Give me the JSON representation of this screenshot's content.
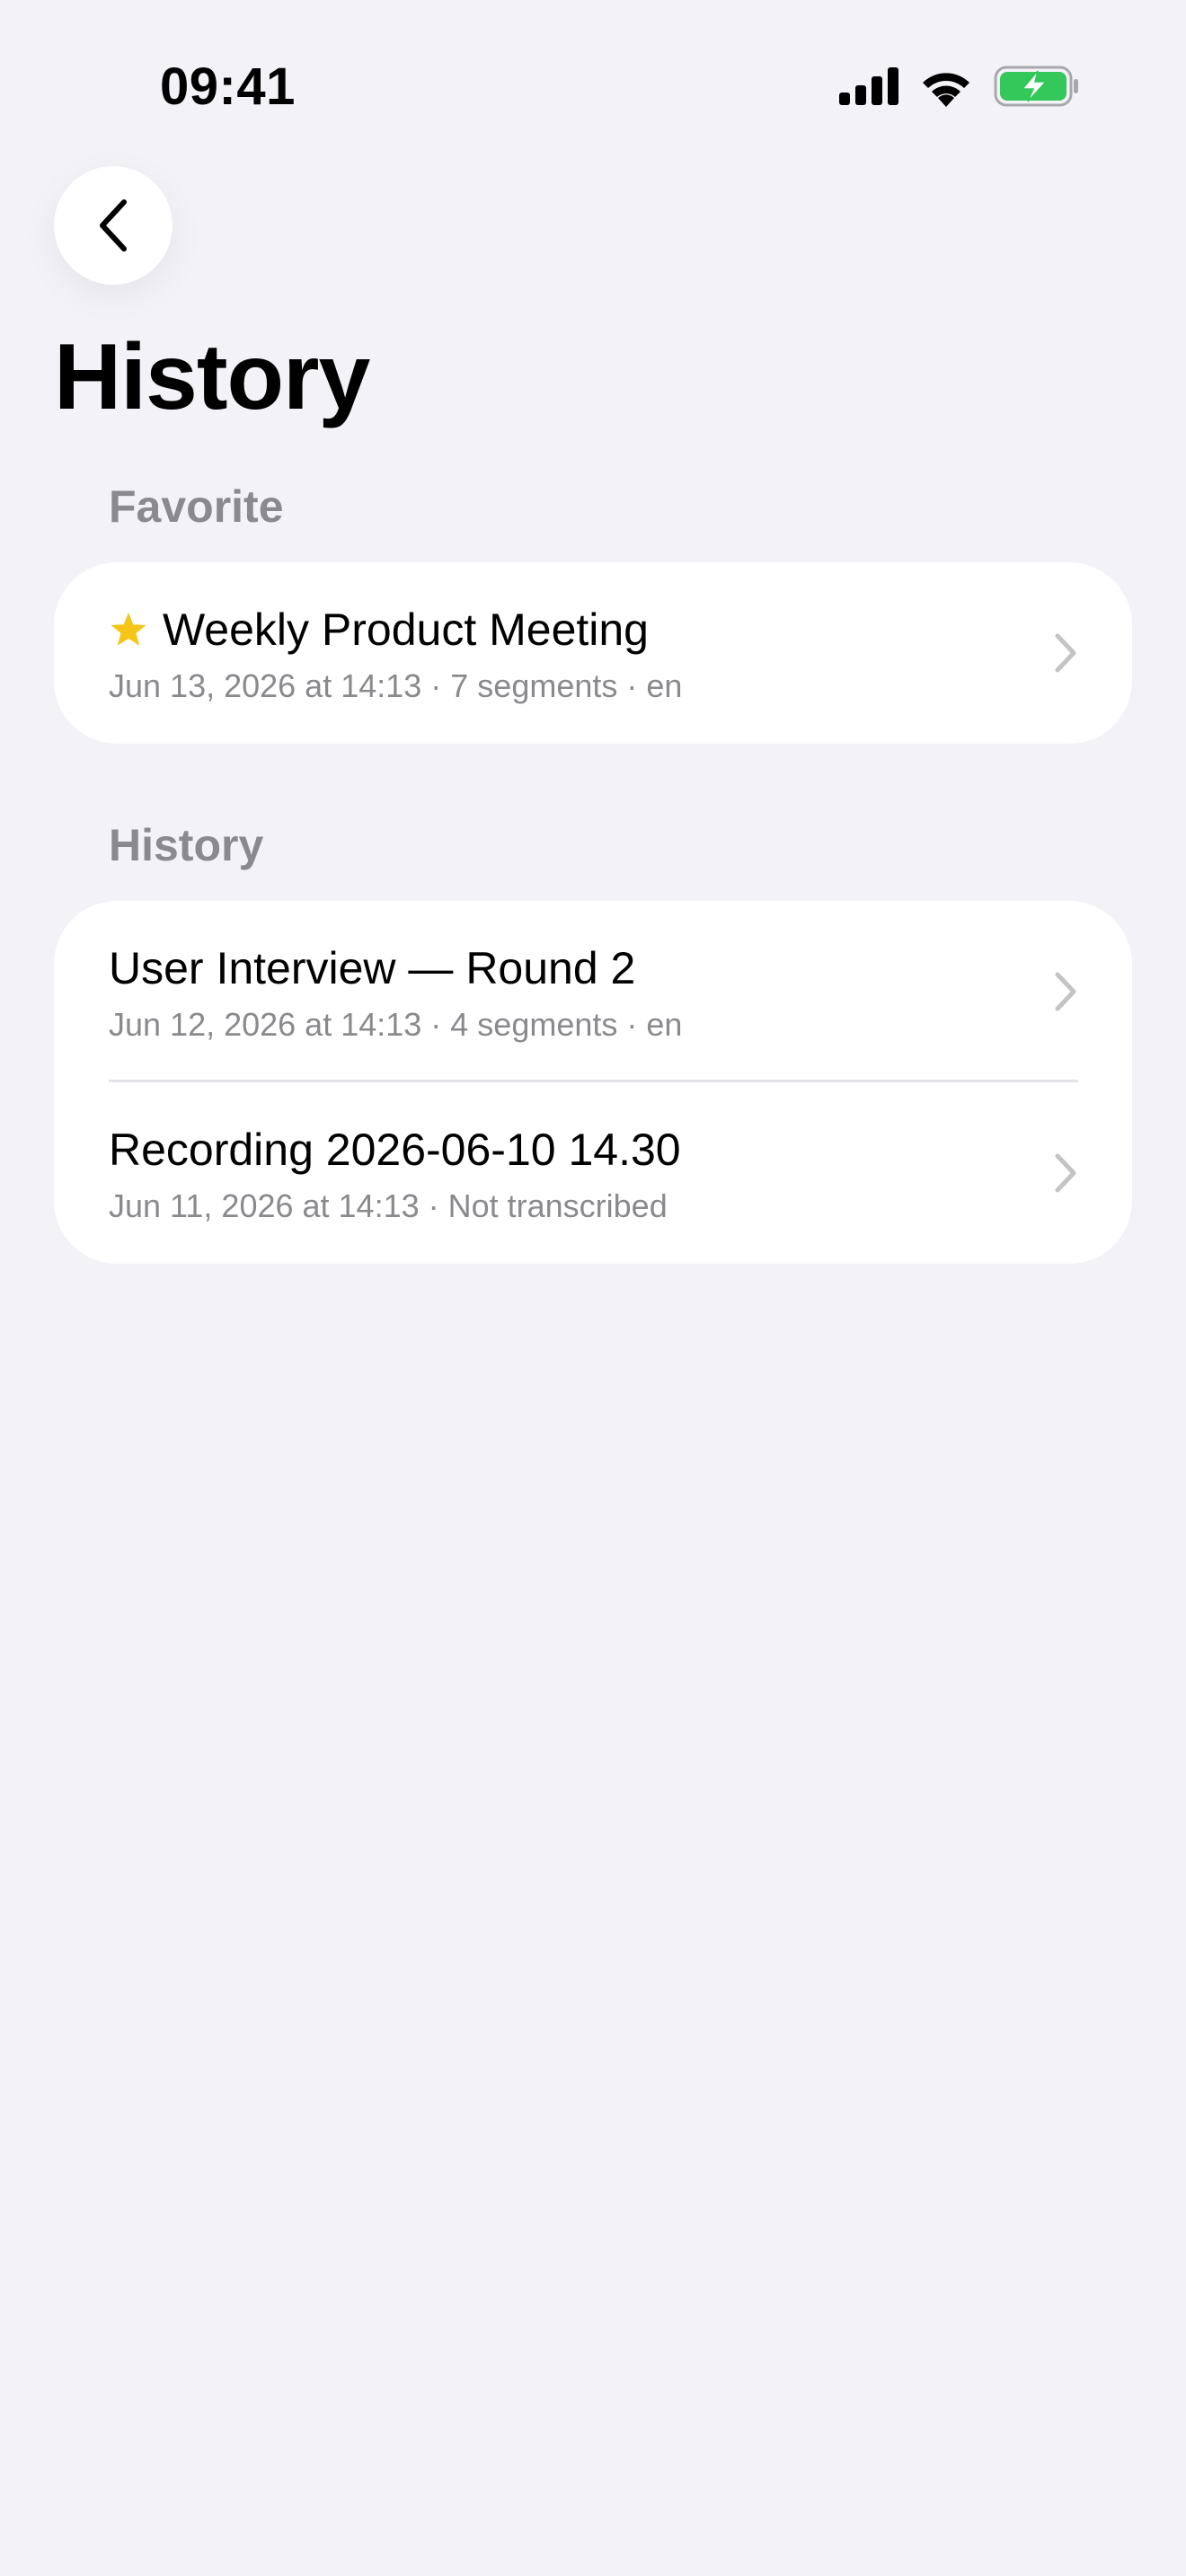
{
  "status_bar": {
    "time": "09:41"
  },
  "nav": {
    "back_icon": "chevron-left-icon",
    "title": "History"
  },
  "sections": {
    "favorite": {
      "header": "Favorite",
      "items": [
        {
          "title": "Weekly Product Meeting",
          "subtitle": "Jun 13, 2026 at 14:13 · 7 segments · en",
          "starred": true
        }
      ]
    },
    "history": {
      "header": "History",
      "items": [
        {
          "title": "User Interview — Round 2",
          "subtitle": "Jun 12, 2026 at 14:13 · 4 segments · en"
        },
        {
          "title": "Recording 2026-06-10 14.30",
          "subtitle": "Jun 11, 2026 at 14:13 · Not transcribed"
        }
      ]
    }
  },
  "colors": {
    "background": "#F2F2F7",
    "card": "#FFFFFF",
    "secondary_text": "#8A8A8E",
    "star": "#F5C518",
    "battery_fill": "#34C759",
    "chevron": "#C4C4C7"
  }
}
